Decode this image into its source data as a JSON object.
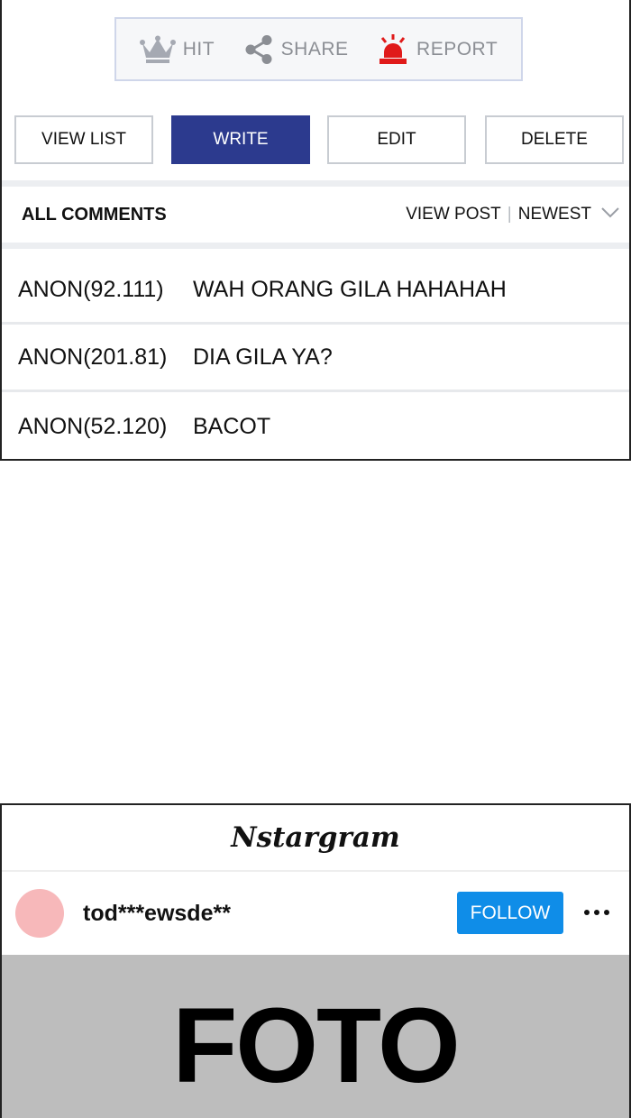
{
  "post_actions": {
    "hit_label": "HIT",
    "share_label": "SHARE",
    "report_label": "REPORT"
  },
  "buttons": {
    "view_list": "VIEW LIST",
    "write": "WRITE",
    "edit": "EDIT",
    "delete": "DELETE"
  },
  "comments_section": {
    "title": "ALL COMMENTS",
    "view_post": "VIEW POST",
    "divider": "|",
    "sort": "NEWEST"
  },
  "comments": [
    {
      "author": "ANON(92.111)",
      "text": "WAH ORANG GILA HAHAHAH"
    },
    {
      "author": "ANON(201.81)",
      "text": "DIA GILA YA?"
    },
    {
      "author": "ANON(52.120)",
      "text": "BACOT"
    }
  ],
  "social_post": {
    "app_name": "Nstargram",
    "username": "tod***ewsde**",
    "follow_label": "FOLLOW",
    "photo_label": "FOTO"
  },
  "colors": {
    "primary_button": "#2c3a8e",
    "report_icon": "#e01a1a",
    "follow_button": "#0f8de8",
    "avatar": "#f7b8ba",
    "photo_placeholder": "#bdbdbd"
  },
  "icons": {
    "hit": "crown-icon",
    "share": "share-icon",
    "report": "siren-icon",
    "sort": "chevron-down-icon",
    "more": "more-horizontal-icon"
  }
}
